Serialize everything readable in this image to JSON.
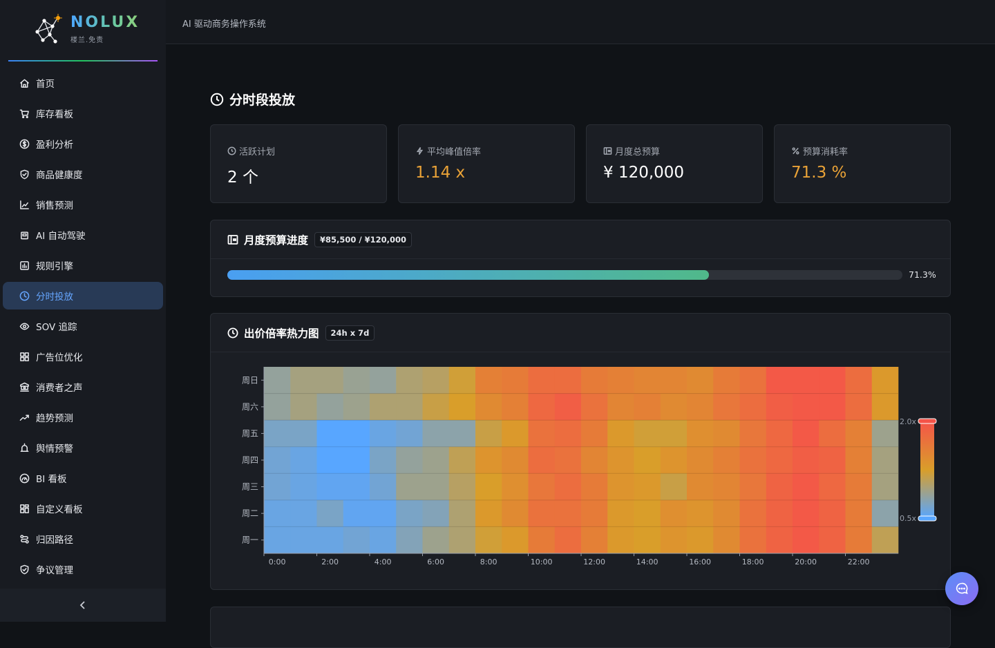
{
  "brand": {
    "name": "NOLUX",
    "subtitle": "楼兰.免责"
  },
  "topbar": {
    "title": "AI 驱动商务操作系统"
  },
  "sidebar": {
    "items": [
      {
        "label": "首页",
        "icon": "home-icon"
      },
      {
        "label": "库存看板",
        "icon": "cart-icon"
      },
      {
        "label": "盈利分析",
        "icon": "dollar-icon"
      },
      {
        "label": "商品健康度",
        "icon": "shield-check-icon"
      },
      {
        "label": "销售预测",
        "icon": "line-chart-icon"
      },
      {
        "label": "AI 自动驾驶",
        "icon": "bot-icon"
      },
      {
        "label": "规则引擎",
        "icon": "rules-icon"
      },
      {
        "label": "分时投放",
        "icon": "clock-icon"
      },
      {
        "label": "SOV 追踪",
        "icon": "eye-icon"
      },
      {
        "label": "广告位优化",
        "icon": "grid-icon"
      },
      {
        "label": "消费者之声",
        "icon": "consumer-icon"
      },
      {
        "label": "趋势预测",
        "icon": "trend-icon"
      },
      {
        "label": "舆情预警",
        "icon": "alarm-icon"
      },
      {
        "label": "BI 看板",
        "icon": "gauge-icon"
      },
      {
        "label": "自定义看板",
        "icon": "layout-icon"
      },
      {
        "label": "归因路径",
        "icon": "route-icon"
      },
      {
        "label": "争议管理",
        "icon": "shield-icon"
      }
    ],
    "active_index": 7
  },
  "page": {
    "title": "分时段投放"
  },
  "stats": [
    {
      "label": "活跃计划",
      "value": "2 个",
      "icon": "clock-icon",
      "accent": false
    },
    {
      "label": "平均峰值倍率",
      "value": "1.14 x",
      "icon": "bolt-icon",
      "accent": true
    },
    {
      "label": "月度总预算",
      "value": "¥ 120,000",
      "icon": "wallet-icon",
      "accent": false
    },
    {
      "label": "预算消耗率",
      "value": "71.3 %",
      "icon": "percent-icon",
      "accent": true
    }
  ],
  "budget": {
    "title": "月度预算进度",
    "tag": "¥85,500 / ¥120,000",
    "progress": 0.713,
    "percent_label": "71.3%"
  },
  "heatmap_panel": {
    "title": "出价倍率热力图",
    "tag": "24h x 7d"
  },
  "colors": {
    "accent": "#66a6ff",
    "orange": "#e9a237",
    "low": "#58a6ff",
    "mid": "#d99e2a",
    "high": "#f55449"
  },
  "chart_data": {
    "type": "heatmap",
    "x_ticks": [
      "0:00",
      "2:00",
      "4:00",
      "6:00",
      "8:00",
      "10:00",
      "12:00",
      "14:00",
      "16:00",
      "18:00",
      "20:00",
      "22:00"
    ],
    "y_labels": [
      "周日",
      "周六",
      "周五",
      "周四",
      "周三",
      "周二",
      "周一"
    ],
    "visual_map": {
      "min": 0.5,
      "max": 2.0,
      "min_label": "0.5x",
      "max_label": "2.0x"
    },
    "values": [
      [
        0.85,
        0.95,
        0.95,
        0.88,
        0.85,
        1.0,
        1.05,
        1.2,
        1.55,
        1.6,
        1.75,
        1.75,
        1.6,
        1.55,
        1.5,
        1.5,
        1.45,
        1.6,
        1.7,
        1.95,
        1.95,
        1.95,
        1.75,
        1.3
      ],
      [
        0.85,
        0.95,
        0.85,
        0.9,
        1.0,
        1.0,
        1.15,
        1.25,
        1.45,
        1.55,
        1.8,
        1.9,
        1.7,
        1.5,
        1.55,
        1.45,
        1.5,
        1.65,
        1.75,
        1.9,
        1.95,
        1.95,
        1.75,
        1.3
      ],
      [
        0.7,
        0.7,
        0.5,
        0.5,
        0.6,
        0.65,
        0.8,
        0.8,
        1.15,
        1.3,
        1.7,
        1.75,
        1.6,
        1.3,
        1.2,
        1.2,
        1.4,
        1.45,
        1.65,
        1.8,
        1.95,
        1.75,
        1.55,
        0.9
      ],
      [
        0.65,
        0.6,
        0.5,
        0.5,
        0.7,
        0.85,
        0.9,
        1.1,
        1.35,
        1.45,
        1.75,
        1.7,
        1.5,
        1.35,
        1.25,
        1.35,
        1.45,
        1.55,
        1.7,
        1.8,
        1.9,
        1.85,
        1.55,
        0.95
      ],
      [
        0.65,
        0.6,
        0.55,
        0.55,
        0.65,
        0.9,
        0.9,
        1.05,
        1.25,
        1.4,
        1.65,
        1.75,
        1.6,
        1.35,
        1.3,
        1.15,
        1.45,
        1.5,
        1.65,
        1.85,
        1.95,
        1.8,
        1.6,
        0.95
      ],
      [
        0.6,
        0.6,
        0.7,
        0.55,
        0.55,
        0.7,
        0.75,
        1.0,
        1.3,
        1.45,
        1.7,
        1.7,
        1.6,
        1.3,
        1.25,
        1.4,
        1.35,
        1.45,
        1.7,
        1.85,
        1.95,
        1.85,
        1.6,
        0.8
      ],
      [
        0.6,
        0.6,
        0.6,
        0.65,
        0.6,
        0.75,
        0.9,
        1.0,
        1.2,
        1.3,
        1.6,
        1.75,
        1.55,
        1.3,
        1.25,
        1.35,
        1.3,
        1.45,
        1.7,
        1.85,
        1.95,
        1.85,
        1.6,
        1.1
      ]
    ]
  },
  "chat_button": {
    "icon": "chat-icon"
  }
}
